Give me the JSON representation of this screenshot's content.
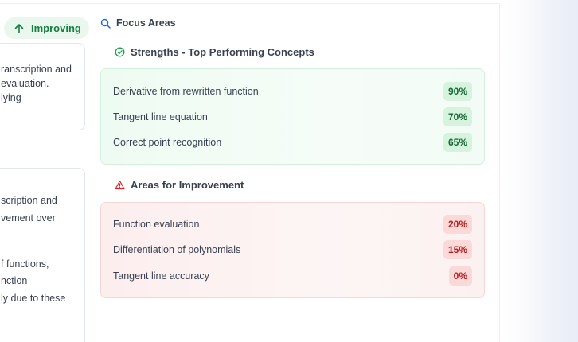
{
  "status": {
    "label": "Improving",
    "icon": "arrow-up-icon"
  },
  "left_card_1": {
    "lines": [
      "ranscription and",
      "evaluation.",
      "lying"
    ]
  },
  "left_card_2": {
    "lines": [
      "scription and",
      "vement over",
      "",
      "f functions,",
      "nction",
      "ly due to these"
    ]
  },
  "focus": {
    "title": "Focus Areas",
    "icon": "search-icon",
    "strengths": {
      "title": "Strengths - Top Performing Concepts",
      "icon": "check-circle-icon",
      "items": [
        {
          "label": "Derivative from rewritten function",
          "value": "90%"
        },
        {
          "label": "Tangent line equation",
          "value": "70%"
        },
        {
          "label": "Correct point recognition",
          "value": "65%"
        }
      ]
    },
    "improvement": {
      "title": "Areas for Improvement",
      "icon": "warning-triangle-icon",
      "items": [
        {
          "label": "Function evaluation",
          "value": "20%"
        },
        {
          "label": "Differentiation of polynomials",
          "value": "15%"
        },
        {
          "label": "Tangent line accuracy",
          "value": "0%"
        }
      ]
    }
  },
  "colors": {
    "success": "#15803d",
    "danger": "#b91c1c",
    "accent": "#2563eb"
  }
}
